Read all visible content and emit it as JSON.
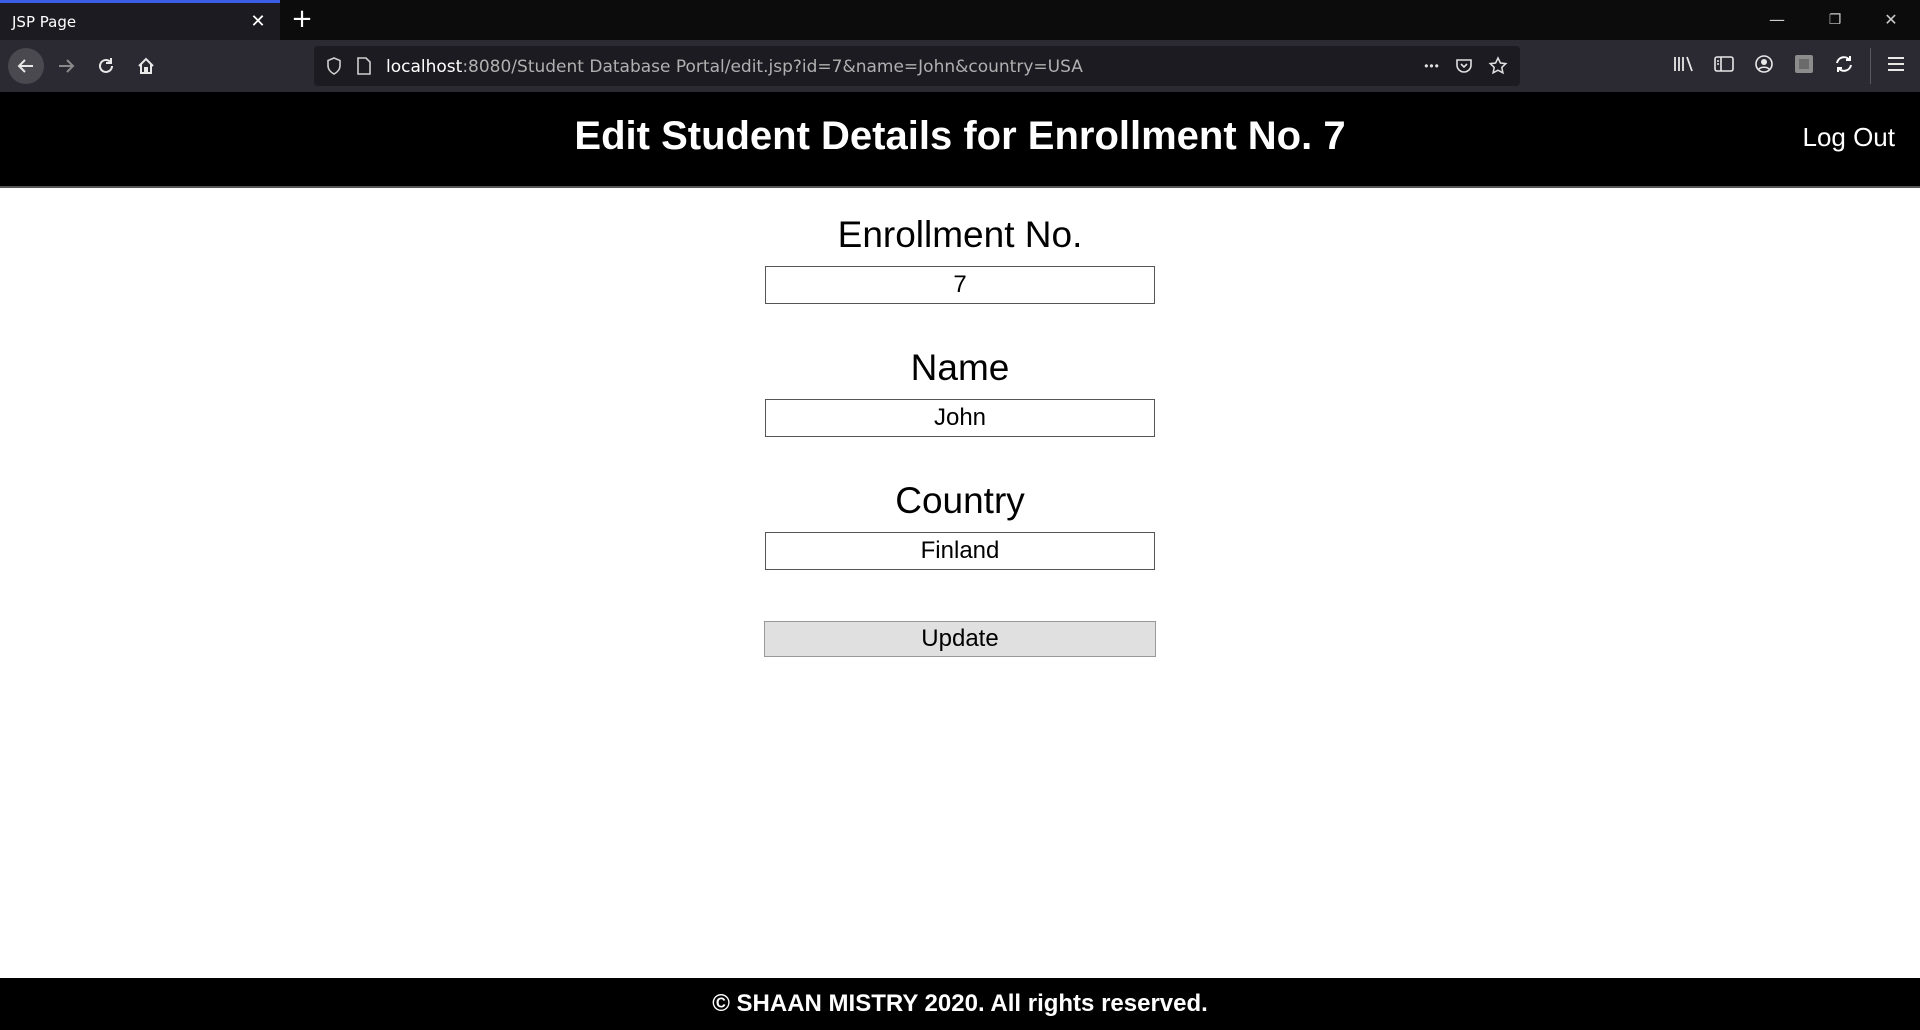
{
  "browser": {
    "tab_title": "JSP Page",
    "close_glyph": "✕",
    "new_tab_glyph": "+",
    "url_host": "localhost",
    "url_rest": ":8080/Student Database Portal/edit.jsp?id=7&name=John&country=USA",
    "window_controls": {
      "minimize": "—",
      "restore": "❐",
      "close": "✕"
    },
    "more_glyph": "•••"
  },
  "header": {
    "title": "Edit Student Details for Enrollment No. 7",
    "logout_label": "Log Out"
  },
  "form": {
    "enrollment": {
      "label": "Enrollment No.",
      "value": "7"
    },
    "name": {
      "label": "Name",
      "value": "John"
    },
    "country": {
      "label": "Country",
      "value": "Finland"
    },
    "submit_label": "Update"
  },
  "footer": {
    "text": "© SHAAN MISTRY 2020. All rights reserved."
  },
  "colors": {
    "header_bg": "#000000",
    "footer_bg": "#000000",
    "button_bg": "#e0e0e0"
  }
}
